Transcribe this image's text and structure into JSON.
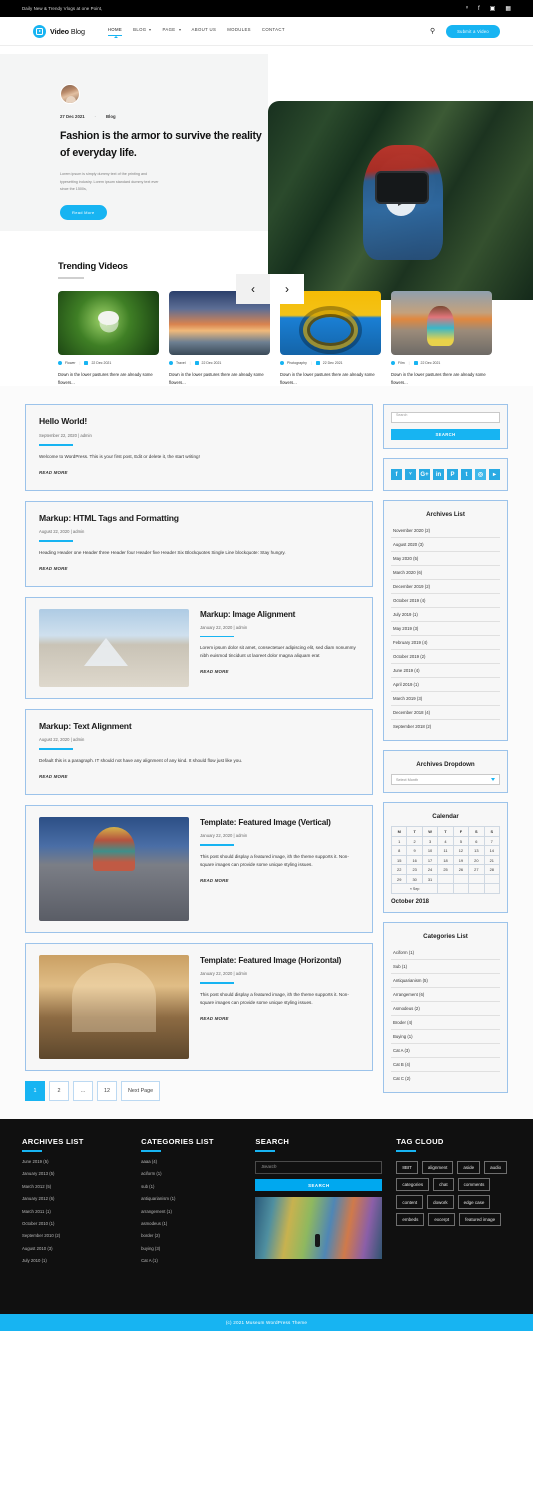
{
  "topbar": {
    "tagline": "Daily New & Trendy Vlogs at one Point,",
    "social": [
      "twitter-icon",
      "facebook-icon",
      "instagram-icon",
      "linkedin-icon"
    ],
    "social_glyphs": [
      "𝘛",
      "f",
      "▣",
      "in"
    ]
  },
  "header": {
    "logo_bold": "Video",
    "logo_light": " Blog",
    "nav": [
      {
        "label": "HOME",
        "has_dropdown": false,
        "active": true
      },
      {
        "label": "BLOG",
        "has_dropdown": true,
        "active": false
      },
      {
        "label": "PAGE",
        "has_dropdown": true,
        "active": false
      },
      {
        "label": "ABOUT US",
        "has_dropdown": false,
        "active": false
      },
      {
        "label": "MODULES",
        "has_dropdown": false,
        "active": false
      },
      {
        "label": "CONTACT",
        "has_dropdown": false,
        "active": false
      }
    ],
    "search_icon": "search-icon",
    "submit_button": "Submit a Video"
  },
  "hero": {
    "date": "27 Dec 2021",
    "separator": "-",
    "category": "Blog",
    "title": "Fashion is the armor to survive the reality of everyday life.",
    "description": "Lorem ipsum is simply dummy text of the printing and typesetting industry. Lorem ipsum standard dummy text ever since the 1500s,",
    "button": "Read More",
    "prev_arrow": "‹",
    "next_arrow": "›"
  },
  "trending": {
    "heading": "Trending Videos",
    "videos": [
      {
        "category": "Flower",
        "date": "22 Dec 2021",
        "excerpt": "Down in the lower pastures there are already some flowers..."
      },
      {
        "category": "Travel",
        "date": "22 Dec 2021",
        "excerpt": "Down in the lower pastures there are already some flowers..."
      },
      {
        "category": "Photography",
        "date": "22 Dec 2021",
        "excerpt": "Down in the lower pastures there are already some flowers..."
      },
      {
        "category": "Film",
        "date": "22 Dec 2021",
        "excerpt": "Down in the lower pastures there are already some flowers..."
      }
    ]
  },
  "posts": [
    {
      "title": "Hello World!",
      "date": "September 22, 2020 | admin",
      "body": "Welcome to WordPress. This is your first post, Edit or delete it, the start writing!",
      "read_more": "READ MORE",
      "layout": "text"
    },
    {
      "title": "Markup: HTML Tags and Formatting",
      "date": "August 22, 2020 | admin",
      "body": "Heading Header one Header three Header four Header five Header Six Blockquotes Single Line blockquote: Stay hungry.",
      "read_more": "READ MORE",
      "layout": "text"
    },
    {
      "title": "Markup: Image Alignment",
      "date": "January 22, 2020 | admin",
      "body": "Lorem ipsum dolor sit amet, consectetuer adipiscing elit, sed diam nonummy nibh euismod tincidunt ut laoreet dolor magna aliquam erat",
      "read_more": "READ MORE",
      "layout": "image-left"
    },
    {
      "title": "Markup: Text Alignment",
      "date": "August 22, 2020 | admin",
      "body": "Default this is a paragraph. IT should not have any alignment of any kind. It should flow just like you.",
      "read_more": "READ MORE",
      "layout": "text"
    },
    {
      "title": "Template: Featured Image (Vertical)",
      "date": "January 22, 2020 | admin",
      "body": "This post should display a featured image, ith the theme supports it. Non-square images can provide some unique styling issues.",
      "read_more": "READ MORE",
      "layout": "image-left-tall"
    },
    {
      "title": "Template: Featured Image (Horizontal)",
      "date": "January 22, 2020 | admin",
      "body": "This post should display a featured image, ith the theme supports it. Non-square images can provide some unique styling issues.",
      "read_more": "READ MORE",
      "layout": "image-left-tall"
    }
  ],
  "pagination": {
    "pages": [
      "1",
      "2",
      "...",
      "12",
      "Next Page"
    ],
    "active": "1"
  },
  "sidebar": {
    "search": {
      "placeholder": "Search",
      "button": "SEARCH"
    },
    "social": [
      {
        "name": "facebook-icon",
        "glyph": "f"
      },
      {
        "name": "twitter-icon",
        "glyph": "ᵛ"
      },
      {
        "name": "google-plus-icon",
        "glyph": "G+"
      },
      {
        "name": "linkedin-icon",
        "glyph": "in"
      },
      {
        "name": "pinterest-icon",
        "glyph": "P"
      },
      {
        "name": "tumblr-icon",
        "glyph": "t"
      },
      {
        "name": "instagram-icon",
        "glyph": "◎"
      },
      {
        "name": "youtube-icon",
        "glyph": "▸"
      }
    ],
    "archives": {
      "title": "Archives List",
      "items": [
        "November 2020 (2)",
        "August 2020 (3)",
        "May 2020 (5)",
        "March 2020 (6)",
        "December 2019 (2)",
        "October 2019 (4)",
        "July 2019 (1)",
        "May 2019 (3)",
        "February 2019 (4)",
        "October 2019 (2)",
        "June 2019 (4)",
        "April 2019 (1)",
        "March 2019 (3)",
        "December 2018 (4)",
        "September 2018 (2)"
      ]
    },
    "archives_dropdown": {
      "title": "Archives Dropdown",
      "selected": "Select Month"
    },
    "calendar": {
      "title": "Calendar",
      "caption": "October 2018",
      "weekdays": [
        "M",
        "T",
        "W",
        "T",
        "F",
        "S",
        "S"
      ],
      "weeks": [
        [
          "1",
          "2",
          "3",
          "4",
          "5",
          "6",
          "7"
        ],
        [
          "8",
          "9",
          "10",
          "11",
          "12",
          "13",
          "14"
        ],
        [
          "15",
          "16",
          "17",
          "18",
          "19",
          "20",
          "21"
        ],
        [
          "22",
          "23",
          "24",
          "25",
          "26",
          "27",
          "28"
        ],
        [
          "29",
          "30",
          "31",
          "",
          "",
          "",
          ""
        ]
      ],
      "prev_label": "« Sep"
    },
    "categories": {
      "title": "Categories List",
      "items": [
        "Aciform (1)",
        "Sub (1)",
        "Antiquarianism (5)",
        "Arrangement (6)",
        "Asmodeus (2)",
        "Broder (4)",
        "Buying (1)",
        "Cat A (3)",
        "Cat B (4)",
        "Cat C (2)"
      ]
    }
  },
  "footer": {
    "archives": {
      "title": "ARCHIVES LIST",
      "items": [
        "June 2019 (5)",
        "January  2013 (5)",
        "March 2012 (5)",
        "January  2012 (6)",
        "March  2011 (1)",
        "October 2010 (1)",
        "September 2010 (2)",
        "August 2010 (3)",
        "July 2010 (1)"
      ]
    },
    "categories": {
      "title": "CATEGORIES LIST",
      "items": [
        "aaaa (4)",
        "aciform (1)",
        "sub (1)",
        "antiquarianism (1)",
        "arrangement (1)",
        "asmodeus (1)",
        "border (2)",
        "buying (3)",
        "Cat A (1)"
      ]
    },
    "search": {
      "title": "SEARCH",
      "placeholder": "Search",
      "button": "SEARCH"
    },
    "tagcloud": {
      "title": "TAG CLOUD",
      "tags": [
        "8BIT",
        "alignment",
        "aside",
        "audio",
        "categories",
        "chat",
        "comments",
        "content",
        "dowork",
        "edge case",
        "embeds",
        "excerpt",
        "featured image"
      ]
    },
    "copyright": "(c) 2021 Museum WordPress Theme"
  },
  "colors": {
    "accent": "#17b4f2",
    "dark": "#101010",
    "border": "#9cc3ea"
  }
}
